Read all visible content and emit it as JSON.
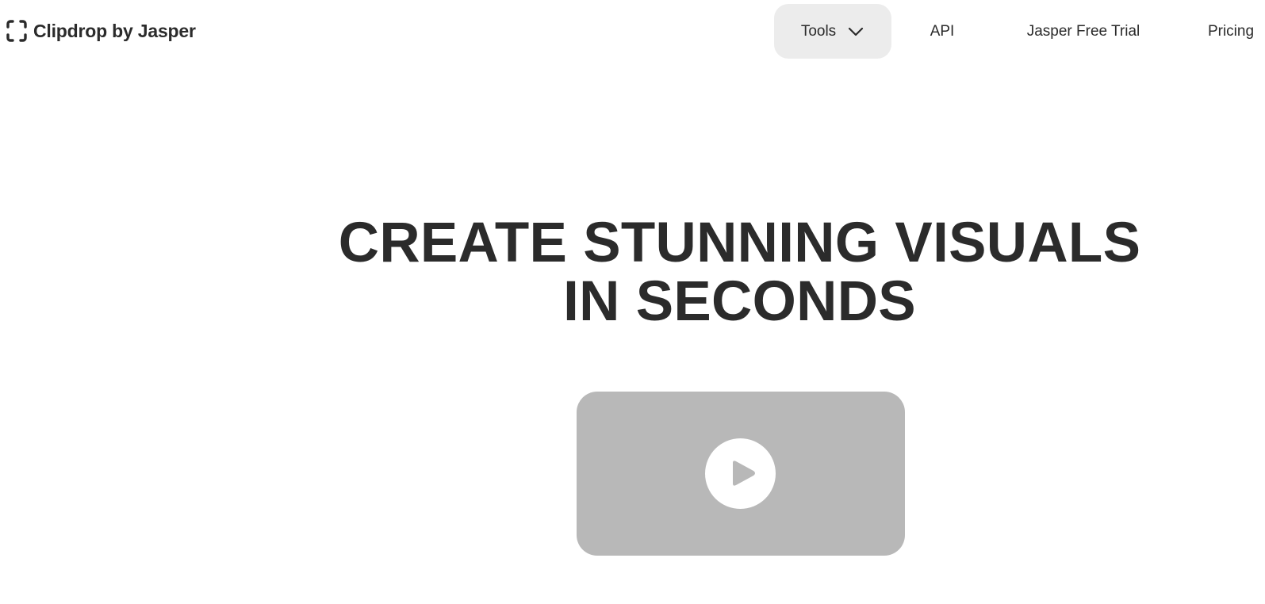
{
  "header": {
    "logo_text": "Clipdrop by Jasper",
    "logo_icon": "clipdrop-logo-icon",
    "nav": {
      "tools_label": "Tools",
      "tools_icon": "chevron-down-icon",
      "api_label": "API",
      "trial_label": "Jasper Free Trial",
      "pricing_label": "Pricing"
    }
  },
  "hero": {
    "title_line1": "CREATE STUNNING VISUALS",
    "title_line2": "IN SECONDS"
  },
  "video": {
    "play_icon": "play-icon"
  },
  "colors": {
    "text": "#2b2b2b",
    "tools_bg": "#ececec",
    "video_bg": "#b8b8b8",
    "play_bg": "#ffffff"
  }
}
